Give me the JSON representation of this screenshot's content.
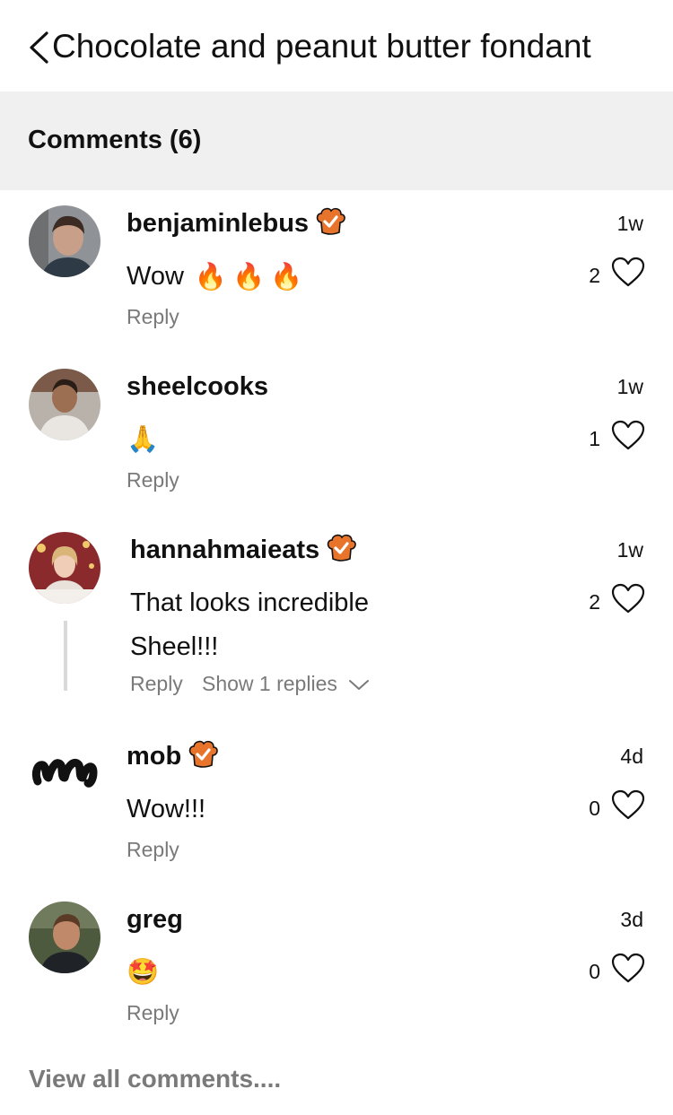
{
  "header": {
    "title": "Chocolate and peanut butter fondant"
  },
  "comments_section": {
    "title": "Comments (6)"
  },
  "comments": [
    {
      "username": "benjaminlebus",
      "verified": true,
      "time": "1w",
      "text": "Wow",
      "emojis": [
        "🔥",
        "🔥",
        "🔥"
      ],
      "likes": "2",
      "reply": "Reply"
    },
    {
      "username": "sheelcooks",
      "verified": false,
      "time": "1w",
      "text": "",
      "emojis": [
        "🙏"
      ],
      "likes": "1",
      "reply": "Reply"
    },
    {
      "username": "hannahmaieats",
      "verified": true,
      "time": "1w",
      "text_line1": "That looks incredible",
      "text_line2": "Sheel!!!",
      "likes": "2",
      "reply": "Reply",
      "show_replies": "Show 1 replies"
    },
    {
      "username": "mob",
      "verified": true,
      "time": "4d",
      "text": "Wow!!!",
      "likes": "0",
      "reply": "Reply"
    },
    {
      "username": "greg",
      "verified": false,
      "time": "3d",
      "text": "",
      "emojis": [
        "🤩"
      ],
      "likes": "0",
      "reply": "Reply"
    }
  ],
  "footer": {
    "view_all": "View all comments...."
  },
  "colors": {
    "section_bg": "#f0f0f0",
    "muted_text": "#7a7a7a",
    "badge_orange": "#e8742c"
  }
}
